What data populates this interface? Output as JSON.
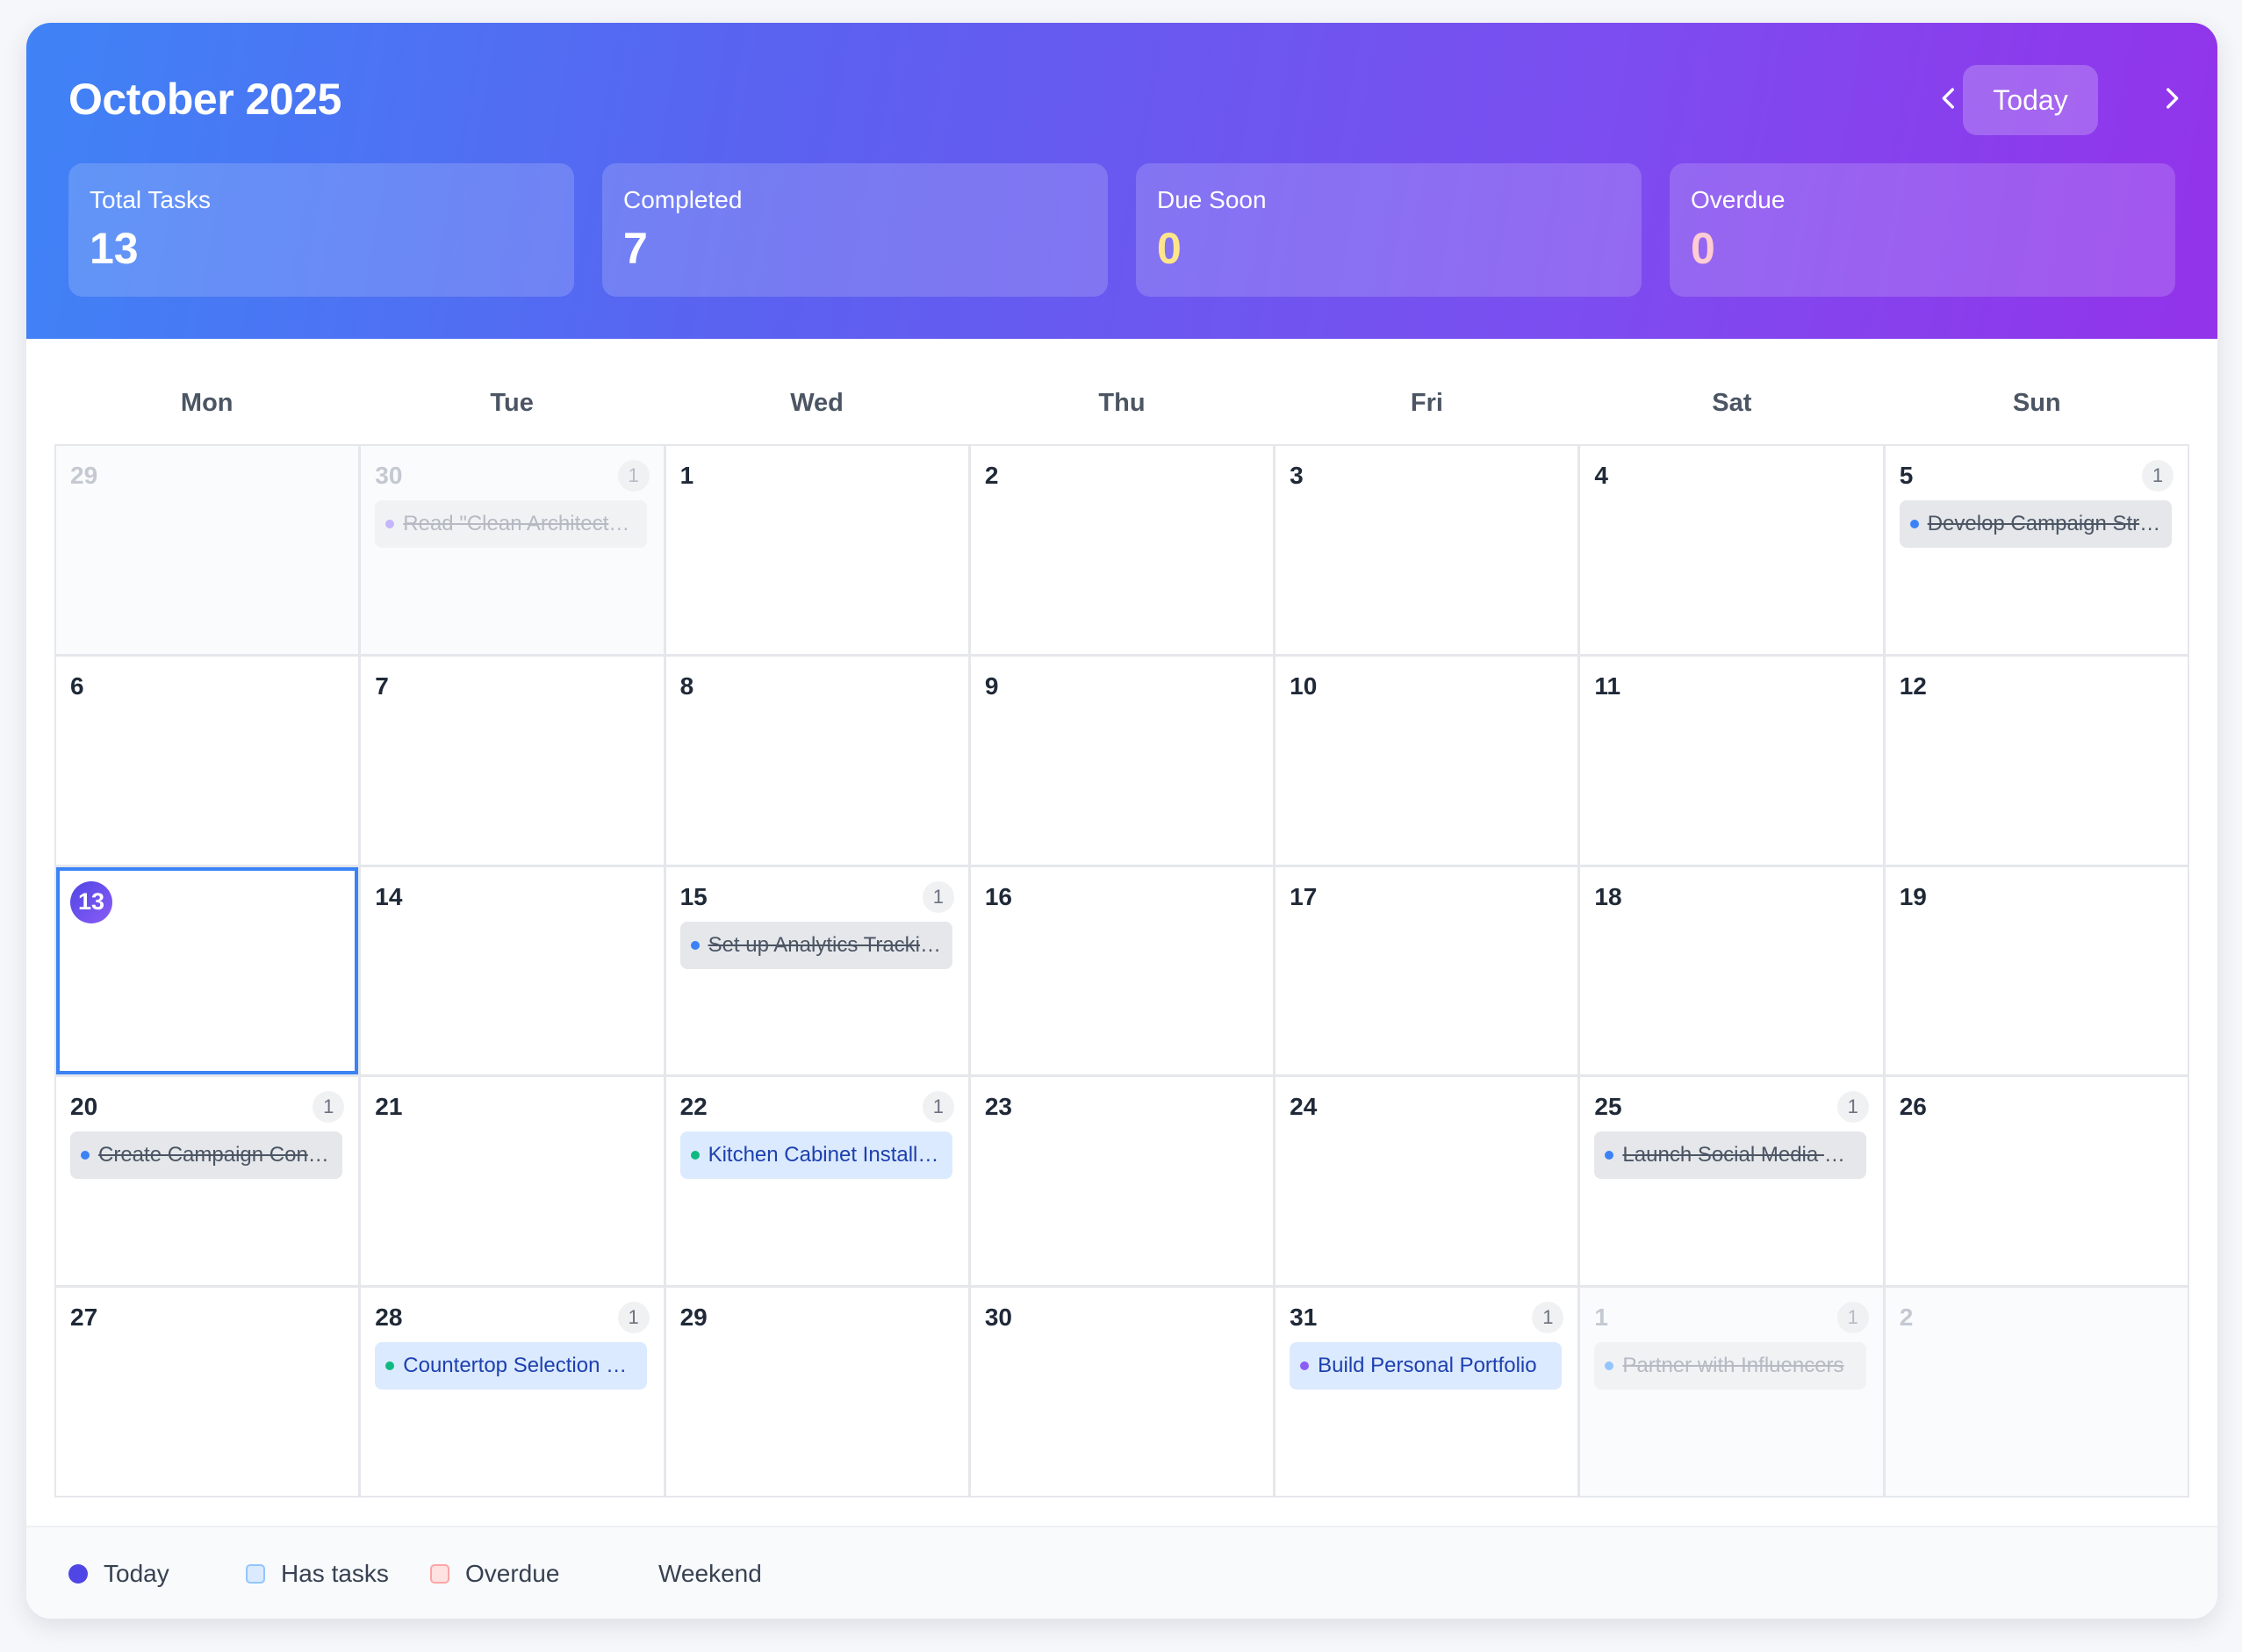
{
  "header": {
    "title": "October 2025",
    "prev_icon": "chevron-left-icon",
    "next_icon": "chevron-right-icon",
    "today_label": "Today"
  },
  "stats": [
    {
      "label": "Total Tasks",
      "value": "13",
      "color": "#ffffff"
    },
    {
      "label": "Completed",
      "value": "7",
      "color": "#ffffff"
    },
    {
      "label": "Due Soon",
      "value": "0",
      "color": "#fde68a"
    },
    {
      "label": "Overdue",
      "value": "0",
      "color": "#fecdd3"
    }
  ],
  "weekdays": [
    "Mon",
    "Tue",
    "Wed",
    "Thu",
    "Fri",
    "Sat",
    "Sun"
  ],
  "days": [
    {
      "num": "29",
      "other": true
    },
    {
      "num": "30",
      "other": true,
      "count": "1",
      "task": {
        "text": "Read \"Clean Architecture\"",
        "done": true,
        "dot": "#c4b5fd"
      }
    },
    {
      "num": "1"
    },
    {
      "num": "2"
    },
    {
      "num": "3"
    },
    {
      "num": "4"
    },
    {
      "num": "5",
      "count": "1",
      "task": {
        "text": "Develop Campaign Strategy",
        "done": true,
        "dot": "#3b82f6"
      }
    },
    {
      "num": "6"
    },
    {
      "num": "7"
    },
    {
      "num": "8"
    },
    {
      "num": "9"
    },
    {
      "num": "10"
    },
    {
      "num": "11"
    },
    {
      "num": "12"
    },
    {
      "num": "13",
      "today": true
    },
    {
      "num": "14"
    },
    {
      "num": "15",
      "count": "1",
      "task": {
        "text": "Set up Analytics Tracking",
        "done": true,
        "dot": "#3b82f6"
      }
    },
    {
      "num": "16"
    },
    {
      "num": "17"
    },
    {
      "num": "18"
    },
    {
      "num": "19"
    },
    {
      "num": "20",
      "count": "1",
      "task": {
        "text": "Create Campaign Content",
        "done": true,
        "dot": "#3b82f6"
      }
    },
    {
      "num": "21"
    },
    {
      "num": "22",
      "count": "1",
      "task": {
        "text": "Kitchen Cabinet Installation",
        "done": false,
        "dot": "#10b981"
      }
    },
    {
      "num": "23"
    },
    {
      "num": "24"
    },
    {
      "num": "25",
      "count": "1",
      "task": {
        "text": "Launch Social Media Campaign",
        "done": true,
        "dot": "#3b82f6"
      }
    },
    {
      "num": "26"
    },
    {
      "num": "27"
    },
    {
      "num": "28",
      "count": "1",
      "task": {
        "text": "Countertop Selection and Order",
        "done": false,
        "dot": "#10b981"
      }
    },
    {
      "num": "29"
    },
    {
      "num": "30"
    },
    {
      "num": "31",
      "count": "1",
      "task": {
        "text": "Build Personal Portfolio",
        "done": false,
        "dot": "#8b5cf6"
      }
    },
    {
      "num": "1",
      "other": true,
      "count": "1",
      "task": {
        "text": "Partner with Influencers",
        "done": true,
        "dot": "#93c5fd"
      }
    },
    {
      "num": "2",
      "other": true
    }
  ],
  "legend": [
    {
      "label": "Today",
      "color": "#4f46e5",
      "shape": "circle"
    },
    {
      "label": "Has tasks",
      "color": "#dbeafe",
      "border": "#93c5fd",
      "shape": "square"
    },
    {
      "label": "Overdue",
      "color": "#fee2e2",
      "border": "#fca5a5",
      "shape": "square"
    },
    {
      "label": "Weekend",
      "color": "#f9fafb",
      "border": "#f9fafb",
      "shape": "square"
    }
  ]
}
